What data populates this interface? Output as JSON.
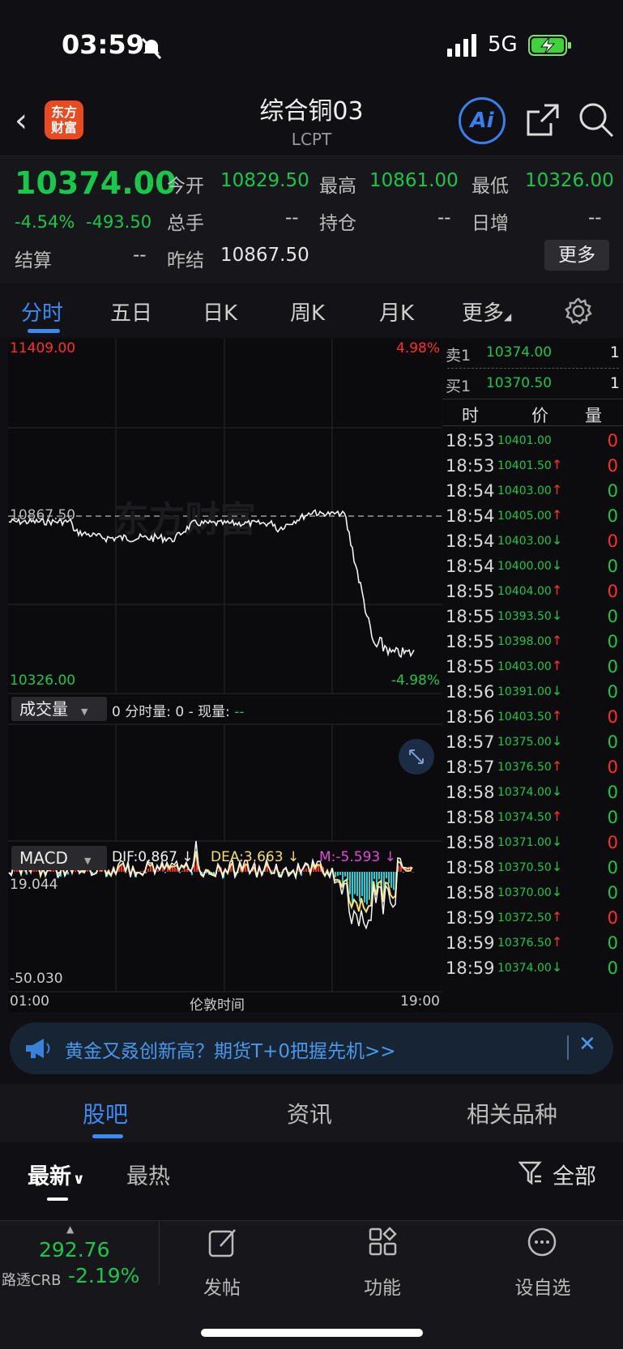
{
  "status": {
    "time": "03:59",
    "network": "5G"
  },
  "header": {
    "logo_text": "东方\n财富",
    "title": "综合铜03",
    "code": "LCPT",
    "ai_label": "Ai"
  },
  "quote": {
    "last": "10374.00",
    "change_pct": "-4.54%",
    "change": "-493.50",
    "open_label": "今开",
    "open": "10829.50",
    "high_label": "最高",
    "high": "10861.00",
    "low_label": "最低",
    "low": "10326.00",
    "volume_label": "总手",
    "volume": "--",
    "position_label": "持仓",
    "position": "--",
    "daily_add_label": "日增",
    "daily_add": "--",
    "settle_label": "结算",
    "settle": "--",
    "prev_settle_label": "昨结",
    "prev_settle": "10867.50",
    "more_label": "更多"
  },
  "chart_tabs": [
    "分时",
    "五日",
    "日K",
    "周K",
    "月K",
    "更多"
  ],
  "chart": {
    "y_top": "11409.00",
    "y_top_pct": "4.98%",
    "ref_price": "10867.50",
    "y_bottom": "10326.00",
    "y_bottom_pct": "-4.98%",
    "watermark": "东方财富",
    "volume_selector": "成交量",
    "volume_info_prefix": "0 分时量: 0 - 现量: ",
    "volume_info_now": "--",
    "macd_selector": "MACD",
    "dif": "DIF:0.867 ↓",
    "dea": "DEA:3.663 ↓",
    "m": "M:-5.593 ↓",
    "macd_top": "19.044",
    "macd_bottom": "-50.030",
    "x_start": "01:00",
    "x_mid": "伦敦时间",
    "x_end": "19:00"
  },
  "orderbook": {
    "ask_label": "卖1",
    "ask_price": "10374.00",
    "ask_vol": "1",
    "bid_label": "买1",
    "bid_price": "10370.50",
    "bid_vol": "1",
    "col_time": "时",
    "col_price": "价",
    "col_vol": "量"
  },
  "ticks": [
    {
      "t": "18:53",
      "p": "10401.00",
      "a": "",
      "v": "0",
      "vc": "red"
    },
    {
      "t": "18:53",
      "p": "10401.50",
      "a": "↑",
      "v": "0",
      "vc": "red"
    },
    {
      "t": "18:54",
      "p": "10403.00",
      "a": "↑",
      "v": "0",
      "vc": "green"
    },
    {
      "t": "18:54",
      "p": "10405.00",
      "a": "↑",
      "v": "0",
      "vc": "green"
    },
    {
      "t": "18:54",
      "p": "10403.00",
      "a": "↓",
      "v": "0",
      "vc": "red"
    },
    {
      "t": "18:54",
      "p": "10400.00",
      "a": "↓",
      "v": "0",
      "vc": "green"
    },
    {
      "t": "18:55",
      "p": "10404.00",
      "a": "↑",
      "v": "0",
      "vc": "red"
    },
    {
      "t": "18:55",
      "p": "10393.50",
      "a": "↓",
      "v": "0",
      "vc": "green"
    },
    {
      "t": "18:55",
      "p": "10398.00",
      "a": "↑",
      "v": "0",
      "vc": "green"
    },
    {
      "t": "18:55",
      "p": "10403.00",
      "a": "↑",
      "v": "0",
      "vc": "green"
    },
    {
      "t": "18:56",
      "p": "10391.00",
      "a": "↓",
      "v": "0",
      "vc": "green"
    },
    {
      "t": "18:56",
      "p": "10403.50",
      "a": "↑",
      "v": "0",
      "vc": "red"
    },
    {
      "t": "18:57",
      "p": "10375.00",
      "a": "↓",
      "v": "0",
      "vc": "green"
    },
    {
      "t": "18:57",
      "p": "10376.50",
      "a": "↑",
      "v": "0",
      "vc": "red"
    },
    {
      "t": "18:58",
      "p": "10374.00",
      "a": "↓",
      "v": "0",
      "vc": "green"
    },
    {
      "t": "18:58",
      "p": "10374.50",
      "a": "↑",
      "v": "0",
      "vc": "green"
    },
    {
      "t": "18:58",
      "p": "10371.00",
      "a": "↓",
      "v": "0",
      "vc": "red"
    },
    {
      "t": "18:58",
      "p": "10370.50",
      "a": "↓",
      "v": "0",
      "vc": "green"
    },
    {
      "t": "18:58",
      "p": "10370.00",
      "a": "↓",
      "v": "0",
      "vc": "green"
    },
    {
      "t": "18:59",
      "p": "10372.50",
      "a": "↑",
      "v": "0",
      "vc": "red"
    },
    {
      "t": "18:59",
      "p": "10376.50",
      "a": "↑",
      "v": "0",
      "vc": "green"
    },
    {
      "t": "18:59",
      "p": "10374.00",
      "a": "↓",
      "v": "0",
      "vc": "green"
    }
  ],
  "banner": {
    "text": "黄金又叒创新高？期货T+0把握先机>>"
  },
  "sub_tabs": [
    "股吧",
    "资讯",
    "相关品种"
  ],
  "filters": {
    "latest": "最新",
    "hot": "最热",
    "all": "全部"
  },
  "bottom": {
    "index_value": "292.76",
    "index_name": "路透CRB",
    "index_change": "-2.19%",
    "post": "发帖",
    "functions": "功能",
    "watchlist": "设自选"
  },
  "colors": {
    "up": "#ff2e2e",
    "down": "#19c84a",
    "accent": "#3a7ff0"
  }
}
